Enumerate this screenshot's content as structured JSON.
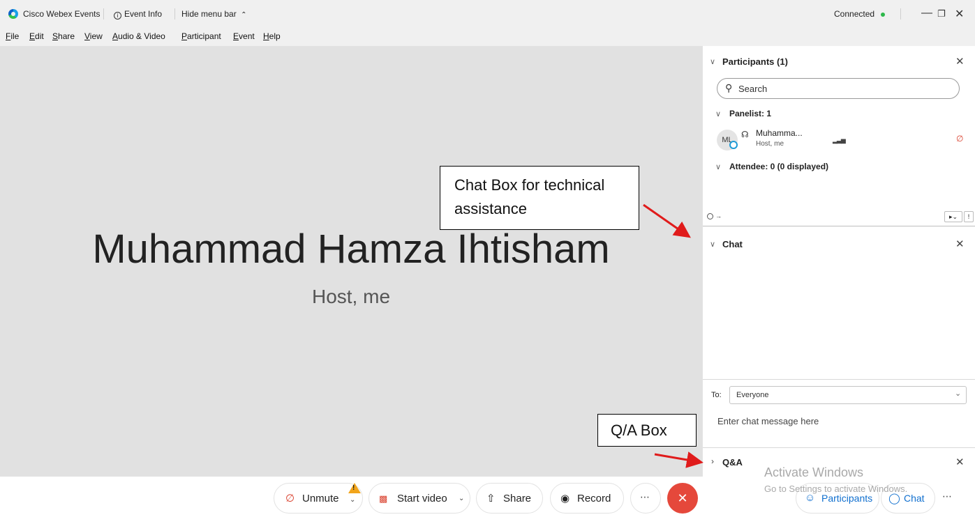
{
  "titlebar": {
    "app_name": "Cisco Webex Events",
    "event_info": "Event Info",
    "hide_menu": "Hide menu bar",
    "status": "Connected",
    "colors": {
      "status_dot": "#2db84b"
    }
  },
  "menu": [
    "File",
    "Edit",
    "Share",
    "View",
    "Audio & Video",
    "Participant",
    "Event",
    "Help"
  ],
  "stage": {
    "name": "Muhammad Hamza Ihtisham",
    "role": "Host, me"
  },
  "participants": {
    "title": "Participants (1)",
    "search_placeholder": "Search",
    "panelist_header": "Panelist: 1",
    "member": {
      "initials": "ML",
      "name": "Muhamma...",
      "role": "Host, me"
    },
    "attendee_header": "Attendee: 0 (0 displayed)"
  },
  "chat": {
    "title": "Chat",
    "to_label": "To:",
    "to_value": "Everyone",
    "placeholder": "Enter chat message here"
  },
  "qa": {
    "title": "Q&A"
  },
  "annotations": {
    "chat_box": "Chat Box for technical assistance",
    "qa_box": "Q/A Box"
  },
  "watermark": {
    "line1": "Activate Windows",
    "line2": "Go to Settings to activate Windows."
  },
  "controls": {
    "unmute": "Unmute",
    "start_video": "Start video",
    "share": "Share",
    "record": "Record",
    "participants": "Participants",
    "chat": "Chat"
  },
  "colors": {
    "accent": "#1170cf",
    "end_call": "#e5483b",
    "mute_red": "#d93f2c",
    "warning": "#f2a51b"
  }
}
